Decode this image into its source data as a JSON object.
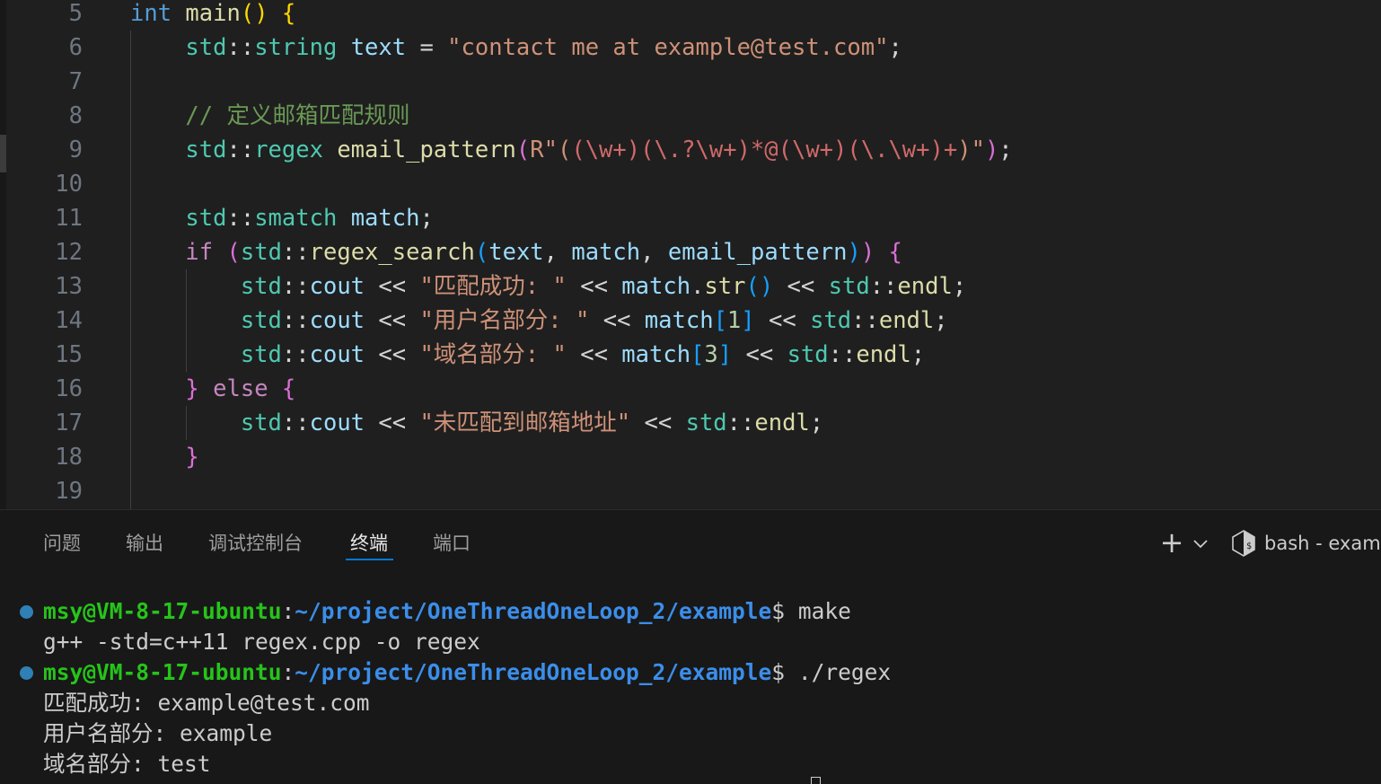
{
  "editor": {
    "lines": [
      {
        "num": "5",
        "tokens": [
          [
            "int",
            "k"
          ],
          [
            " ",
            "p"
          ],
          [
            "main",
            "f"
          ],
          [
            "(",
            "b1"
          ],
          [
            ")",
            "b1"
          ],
          [
            " ",
            "p"
          ],
          [
            "{",
            "b1"
          ]
        ]
      },
      {
        "num": "6",
        "tokens": [
          [
            "    ",
            "p"
          ],
          [
            "std",
            "ty"
          ],
          [
            "::",
            "p"
          ],
          [
            "string",
            "ty"
          ],
          [
            " ",
            "p"
          ],
          [
            "text",
            "v"
          ],
          [
            " = ",
            "p"
          ],
          [
            "\"contact me at example@test.com\"",
            "s"
          ],
          [
            ";",
            "p"
          ]
        ]
      },
      {
        "num": "7",
        "tokens": []
      },
      {
        "num": "8",
        "tokens": [
          [
            "    ",
            "p"
          ],
          [
            "// 定义邮箱匹配规则",
            "cm"
          ]
        ]
      },
      {
        "num": "9",
        "tokens": [
          [
            "    ",
            "p"
          ],
          [
            "std",
            "ty"
          ],
          [
            "::",
            "p"
          ],
          [
            "regex",
            "ty"
          ],
          [
            " ",
            "p"
          ],
          [
            "email_pattern",
            "f"
          ],
          [
            "(",
            "b2"
          ],
          [
            "R\"(",
            "s"
          ],
          [
            "(\\w+)(\\.?\\w+)*@(\\w+)(\\.\\w+)+",
            "re"
          ],
          [
            ")\"",
            "s"
          ],
          [
            ")",
            "b2"
          ],
          [
            ";",
            "p"
          ]
        ]
      },
      {
        "num": "10",
        "tokens": []
      },
      {
        "num": "11",
        "tokens": [
          [
            "    ",
            "p"
          ],
          [
            "std",
            "ty"
          ],
          [
            "::",
            "p"
          ],
          [
            "smatch",
            "ty"
          ],
          [
            " ",
            "p"
          ],
          [
            "match",
            "v"
          ],
          [
            ";",
            "p"
          ]
        ]
      },
      {
        "num": "12",
        "tokens": [
          [
            "    ",
            "p"
          ],
          [
            "if",
            "c"
          ],
          [
            " ",
            "p"
          ],
          [
            "(",
            "b2"
          ],
          [
            "std",
            "ty"
          ],
          [
            "::",
            "p"
          ],
          [
            "regex_search",
            "f"
          ],
          [
            "(",
            "b3"
          ],
          [
            "text",
            "v"
          ],
          [
            ", ",
            "p"
          ],
          [
            "match",
            "v"
          ],
          [
            ", ",
            "p"
          ],
          [
            "email_pattern",
            "v"
          ],
          [
            ")",
            "b3"
          ],
          [
            ")",
            "b2"
          ],
          [
            " ",
            "p"
          ],
          [
            "{",
            "b2"
          ]
        ]
      },
      {
        "num": "13",
        "tokens": [
          [
            "        ",
            "p"
          ],
          [
            "std",
            "ty"
          ],
          [
            "::",
            "p"
          ],
          [
            "cout",
            "v"
          ],
          [
            " << ",
            "p"
          ],
          [
            "\"匹配成功: \"",
            "s"
          ],
          [
            " << ",
            "p"
          ],
          [
            "match",
            "v"
          ],
          [
            ".",
            "p"
          ],
          [
            "str",
            "f"
          ],
          [
            "(",
            "b3"
          ],
          [
            ")",
            "b3"
          ],
          [
            " << ",
            "p"
          ],
          [
            "std",
            "ty"
          ],
          [
            "::",
            "p"
          ],
          [
            "endl",
            "f"
          ],
          [
            ";",
            "p"
          ]
        ]
      },
      {
        "num": "14",
        "tokens": [
          [
            "        ",
            "p"
          ],
          [
            "std",
            "ty"
          ],
          [
            "::",
            "p"
          ],
          [
            "cout",
            "v"
          ],
          [
            " << ",
            "p"
          ],
          [
            "\"用户名部分: \"",
            "s"
          ],
          [
            " << ",
            "p"
          ],
          [
            "match",
            "v"
          ],
          [
            "[",
            "b3"
          ],
          [
            "1",
            "n"
          ],
          [
            "]",
            "b3"
          ],
          [
            " << ",
            "p"
          ],
          [
            "std",
            "ty"
          ],
          [
            "::",
            "p"
          ],
          [
            "endl",
            "f"
          ],
          [
            ";",
            "p"
          ]
        ]
      },
      {
        "num": "15",
        "tokens": [
          [
            "        ",
            "p"
          ],
          [
            "std",
            "ty"
          ],
          [
            "::",
            "p"
          ],
          [
            "cout",
            "v"
          ],
          [
            " << ",
            "p"
          ],
          [
            "\"域名部分: \"",
            "s"
          ],
          [
            " << ",
            "p"
          ],
          [
            "match",
            "v"
          ],
          [
            "[",
            "b3"
          ],
          [
            "3",
            "n"
          ],
          [
            "]",
            "b3"
          ],
          [
            " << ",
            "p"
          ],
          [
            "std",
            "ty"
          ],
          [
            "::",
            "p"
          ],
          [
            "endl",
            "f"
          ],
          [
            ";",
            "p"
          ]
        ]
      },
      {
        "num": "16",
        "tokens": [
          [
            "    ",
            "p"
          ],
          [
            "}",
            "b2"
          ],
          [
            " ",
            "p"
          ],
          [
            "else",
            "c"
          ],
          [
            " ",
            "p"
          ],
          [
            "{",
            "b2"
          ]
        ]
      },
      {
        "num": "17",
        "tokens": [
          [
            "        ",
            "p"
          ],
          [
            "std",
            "ty"
          ],
          [
            "::",
            "p"
          ],
          [
            "cout",
            "v"
          ],
          [
            " << ",
            "p"
          ],
          [
            "\"未匹配到邮箱地址\"",
            "s"
          ],
          [
            " << ",
            "p"
          ],
          [
            "std",
            "ty"
          ],
          [
            "::",
            "p"
          ],
          [
            "endl",
            "f"
          ],
          [
            ";",
            "p"
          ]
        ]
      },
      {
        "num": "18",
        "tokens": [
          [
            "    ",
            "p"
          ],
          [
            "}",
            "b2"
          ]
        ]
      },
      {
        "num": "19",
        "tokens": []
      }
    ]
  },
  "panel": {
    "tabs": [
      {
        "label": "问题",
        "active": false
      },
      {
        "label": "输出",
        "active": false
      },
      {
        "label": "调试控制台",
        "active": false
      },
      {
        "label": "终端",
        "active": true
      },
      {
        "label": "端口",
        "active": false
      }
    ],
    "new_terminal_label": "+",
    "terminal_instance_label": "bash - examp",
    "terminal_lines": [
      {
        "type": "prompt",
        "user": "msy@VM-8-17-ubuntu",
        "sep": ":",
        "path": "~/project/OneThreadOneLoop_2/example",
        "dollar": "$ ",
        "cmd": "make"
      },
      {
        "type": "output",
        "text": "g++ -std=c++11 regex.cpp -o regex"
      },
      {
        "type": "prompt",
        "user": "msy@VM-8-17-ubuntu",
        "sep": ":",
        "path": "~/project/OneThreadOneLoop_2/example",
        "dollar": "$ ",
        "cmd": "./regex"
      },
      {
        "type": "output",
        "text": "匹配成功: example@test.com"
      },
      {
        "type": "output",
        "text": "用户名部分: example"
      },
      {
        "type": "output",
        "text": "域名部分: test"
      }
    ]
  },
  "colors": {
    "keyword": "#569cd6",
    "control": "#c586c0",
    "type": "#4ec9b0",
    "function": "#dcdcaa",
    "variable": "#9cdcfe",
    "string": "#ce9178",
    "regex": "#d16969",
    "comment": "#6a9955",
    "number": "#b5cea8",
    "terminal_user": "#26c41a",
    "terminal_path": "#3b8eea",
    "active_tab_accent": "#0078d4"
  }
}
